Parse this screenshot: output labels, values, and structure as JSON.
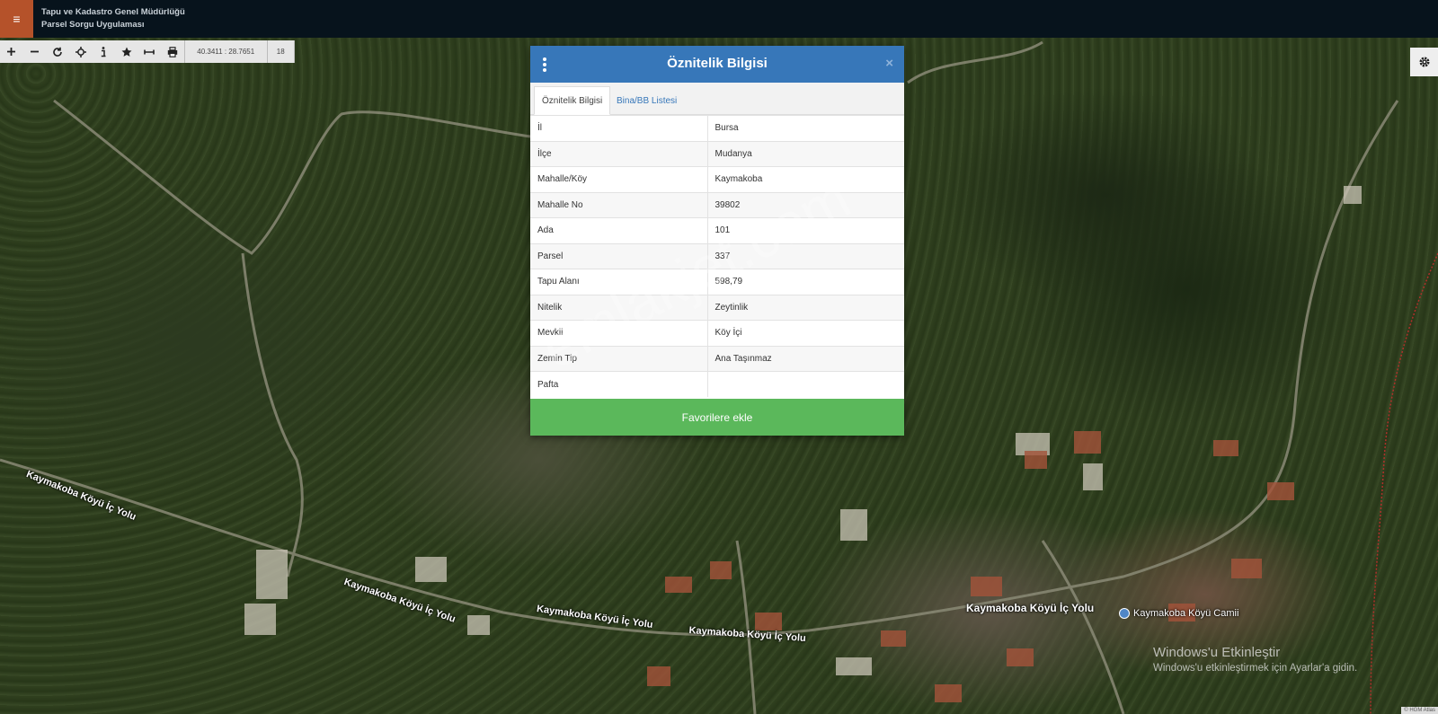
{
  "header": {
    "title_line1": "Tapu ve Kadastro Genel Müdürlüğü",
    "title_line2": "Parsel Sorgu Uygulaması",
    "menu_glyph": "≡"
  },
  "toolbar": {
    "coordinates": "40.3411 : 28.7651",
    "zoom_level": "18"
  },
  "popup": {
    "title": "Öznitelik Bilgisi",
    "close_glyph": "×",
    "tabs": [
      "Öznitelik Bilgisi",
      "Bina/BB Listesi"
    ],
    "rows": [
      {
        "key": "İl",
        "value": "Bursa"
      },
      {
        "key": "İlçe",
        "value": "Mudanya"
      },
      {
        "key": "Mahalle/Köy",
        "value": "Kaymakoba"
      },
      {
        "key": "Mahalle No",
        "value": "39802"
      },
      {
        "key": "Ada",
        "value": "101"
      },
      {
        "key": "Parsel",
        "value": "337"
      },
      {
        "key": "Tapu Alanı",
        "value": "598,79"
      },
      {
        "key": "Nitelik",
        "value": "Zeytinlik"
      },
      {
        "key": "Mevkii",
        "value": "Köy İçi"
      },
      {
        "key": "Zemin Tip",
        "value": "Ana Taşınmaz"
      },
      {
        "key": "Pafta",
        "value": ""
      }
    ],
    "favorite_button": "Favorilere ekle"
  },
  "map": {
    "road_labels": [
      "Kaymakoba Köyü İç Yolu",
      "Kaymakoba Köyü İç Yolu",
      "Kaymakoba Köyü İç Yolu",
      "Kaymakoba Köyü İç Yolu",
      "Kaymakoba Köyü İç Yolu"
    ],
    "poi_label": "Kaymakoba Köyü Camii",
    "copyright": "© HGM Atlas"
  },
  "watermark": "emlakjet.com",
  "windows_activation": {
    "title": "Windows'u Etkinleştir",
    "subtitle": "Windows'u etkinleştirmek için Ayarlar'a gidin."
  },
  "colors": {
    "header_bg": "#07131c",
    "menu_accent": "#b5522a",
    "popup_header": "#3777b9",
    "favorite_button": "#5bb85b"
  },
  "icons": [
    "menu-icon",
    "zoom-in-icon",
    "zoom-out-icon",
    "refresh-icon",
    "locate-icon",
    "info-icon",
    "star-icon",
    "measure-icon",
    "print-icon",
    "gear-icon",
    "kebab-menu-icon",
    "close-icon",
    "mosque-pin-icon"
  ]
}
